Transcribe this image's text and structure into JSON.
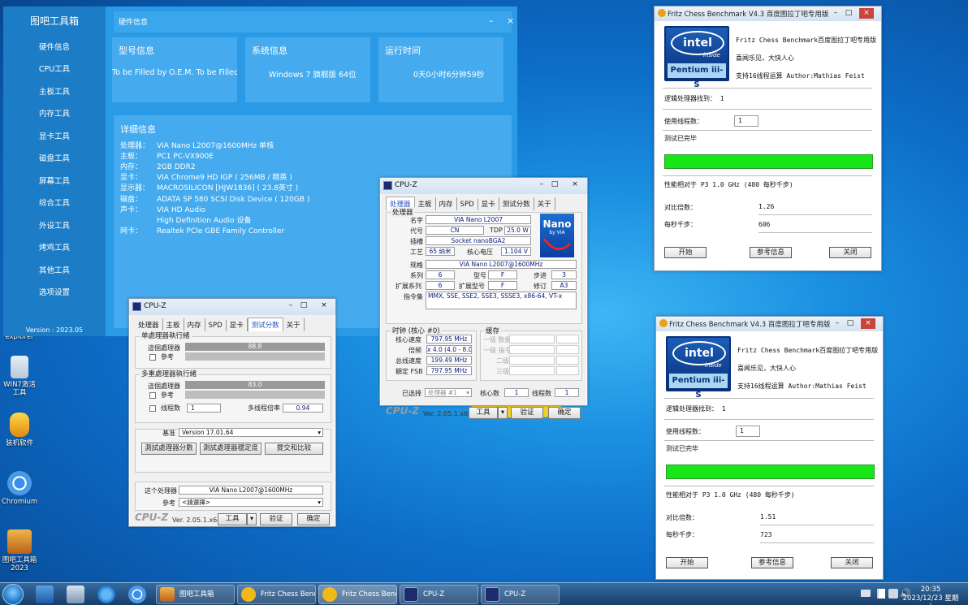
{
  "toolbox": {
    "app_title": "图吧工具箱",
    "nav": [
      "硬件信息",
      "CPU工具",
      "主板工具",
      "内存工具",
      "显卡工具",
      "磁盘工具",
      "屏幕工具",
      "综合工具",
      "外设工具",
      "烤鸡工具",
      "其他工具",
      "选项设置"
    ],
    "version": "Version : 2023.05",
    "header_title": "硬件信息",
    "cards": [
      {
        "title": "型号信息",
        "value": "To be Filled by O.E.M. To be Filled by O.E"
      },
      {
        "title": "系统信息",
        "value": "Windows 7 旗舰版 64位"
      },
      {
        "title": "运行时间",
        "value": "0天0小时6分钟59秒"
      }
    ],
    "detail_title": "详细信息",
    "details": [
      {
        "k": "处理器：",
        "v": "VIA Nano L2007@1600MHz 单核"
      },
      {
        "k": "主板：",
        "v": "PC1 PC-VX900E"
      },
      {
        "k": "内存：",
        "v": "2GB DDR2"
      },
      {
        "k": "显卡：",
        "v": "VIA Chrome9 HD IGP ( 256MB / 精英 )"
      },
      {
        "k": "显示器：",
        "v": "MACROSILICON [HJW1836] ( 23.8英寸 )"
      },
      {
        "k": "磁盘：",
        "v": "ADATA SP 580 SCSI Disk Device ( 120GB )"
      },
      {
        "k": "声卡：",
        "v": "VIA HD Audio"
      },
      {
        "k": "",
        "v": "High Definition Audio 设备"
      },
      {
        "k": "网卡：",
        "v": "Realtek PCIe GBE Family Controller"
      }
    ]
  },
  "desktop_icons": [
    {
      "label": "explorer",
      "icon": "explorer-icon"
    },
    {
      "label": "WIN7激活工具",
      "icon": "activation-tool-icon"
    },
    {
      "label": "装机软件",
      "icon": "software-installer-icon"
    },
    {
      "label": "Chromium",
      "icon": "chromium-icon"
    },
    {
      "label": "图吧工具箱2023",
      "icon": "toolbox-icon"
    }
  ],
  "cpuz_bench": {
    "title": "CPU-Z",
    "tabs": [
      "处理器",
      "主板",
      "内存",
      "SPD",
      "显卡",
      "测试分数",
      "关于"
    ],
    "active_tab": "测试分数",
    "single_group": "单處理器執行緒",
    "single_this_label": "這個處理器",
    "single_this_value": "88.8",
    "single_this_pct": 1.0,
    "ref_label": "參考",
    "multi_group": "多重處理器執行緒",
    "multi_this_label": "這個處理器",
    "multi_this_value": "83.0",
    "multi_this_pct": 1.0,
    "threads_label": "线程数",
    "threads_value": "1",
    "ratio_label": "多线程倍率",
    "ratio_value": "0.94",
    "base_label": "基准",
    "base_value": "Version 17.01.64",
    "btn_bench": "測試處理器分數",
    "btn_stress": "測試處理器穩定度",
    "btn_submit": "提交和比较",
    "this_cpu_label": "这个处理器",
    "this_cpu_value": "VIA Nano L2007@1600MHz",
    "ref2_label": "參考",
    "ref2_value": "<請選擇>",
    "brand": "CPU-Z",
    "version": "Ver. 2.05.1.x64",
    "tools": "工具",
    "validate": "验证",
    "ok": "确定"
  },
  "cpuz_cpu": {
    "title": "CPU-Z",
    "tabs": [
      "处理器",
      "主板",
      "内存",
      "SPD",
      "显卡",
      "测试分数",
      "关于"
    ],
    "active_tab": "处理器",
    "group": "处理器",
    "name_label": "名字",
    "name": "VIA Nano L2007",
    "code_label": "代号",
    "code": "CN",
    "tdp_label": "TDP",
    "tdp": "25.0 W",
    "socket_label": "插槽",
    "socket": "Socket nanoBGA2",
    "tech_label": "工艺",
    "tech": "65 纳米",
    "volt_label": "核心电压",
    "volt": "1.104 V",
    "spec_label": "规格",
    "spec": "VIA Nano L2007@1600MHz",
    "family_label": "系列",
    "family": "6",
    "model_label": "型号",
    "model": "F",
    "stepping_label": "步进",
    "stepping": "3",
    "extfam_label": "扩展系列",
    "extfam": "6",
    "extmodel_label": "扩展型号",
    "extmodel": "F",
    "rev_label": "修订",
    "rev": "A3",
    "instr_label": "指令集",
    "instr": "MMX, SSE, SSE2, SSE3, SSSE3, x86-64, VT-x",
    "clock_group": "时钟 (核心 #0)",
    "core_speed_label": "核心速度",
    "core_speed": "797.95 MHz",
    "mult_label": "倍频",
    "mult": "x 4.0 (4.0 - 8.0)",
    "bus_label": "总线速度",
    "bus": "199.49 MHz",
    "fsb_label": "額定 FSB",
    "fsb": "797.95 MHz",
    "cache_group": "缓存",
    "cache_rows": [
      "一级 数据",
      "一级 指令",
      "二级",
      "三级"
    ],
    "selected_label": "已选择",
    "selected": "处理器 #1",
    "cores_label": "核心数",
    "cores": "1",
    "threads_label": "线程数",
    "threads": "1",
    "logo_text": "Nano",
    "logo_sub": "by VIA",
    "brand": "CPU-Z",
    "version": "Ver. 2.05.1.x64",
    "tools": "工具",
    "validate": "验证",
    "ok": "确定"
  },
  "fritz": [
    {
      "title": "Fritz Chess Benchmark V4.3  百度图拉丁吧专用版",
      "l1": "Fritz Chess Benchmark百度图拉丁吧专用版",
      "l2": "喜闻乐见，大快人心",
      "l3": "支持16线程运算   Author:Mathias Feist",
      "logical_label": "逻辑处理器找到：  1",
      "threads_label": "使用线程数：",
      "threads": "1",
      "status": "测试已完毕",
      "progress": 1.0,
      "perf": "性能相对于 P3 1.0 GHz (480 每秒千步)",
      "ratio_label": "对比倍数：",
      "ratio": "1.26",
      "kn_label": "每秒千步：",
      "kn": "606",
      "start": "开始",
      "ref": "参考信息",
      "close": "关闭",
      "intel": "intel",
      "inside": "inside",
      "pentium": "Pentium iii-S"
    },
    {
      "title": "Fritz Chess Benchmark V4.3  百度图拉丁吧专用版",
      "l1": "Fritz Chess Benchmark百度图拉丁吧专用版",
      "l2": "喜闻乐见，大快人心",
      "l3": "支持16线程运算   Author:Mathias Feist",
      "logical_label": "逻辑处理器找到：  1",
      "threads_label": "使用线程数：",
      "threads": "1",
      "status": "测试已完毕",
      "progress": 1.0,
      "perf": "性能相对于 P3 1.0 GHz (480 每秒千步)",
      "ratio_label": "对比倍数：",
      "ratio": "1.51",
      "kn_label": "每秒千步：",
      "kn": "723",
      "start": "开始",
      "ref": "参考信息",
      "close": "关闭",
      "intel": "intel",
      "inside": "inside",
      "pentium": "Pentium iii-S"
    }
  ],
  "taskbar": {
    "buttons": [
      "图吧工具箱",
      "Fritz Chess Benc...",
      "Fritz Chess Benc...",
      "CPU-Z",
      "CPU-Z"
    ],
    "time": "20:35",
    "date": "2023/12/23 星期六"
  }
}
